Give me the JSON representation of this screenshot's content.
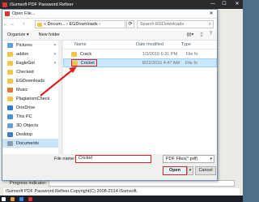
{
  "app": {
    "title": "iSumsoft PDF Password Refixer",
    "min": "—",
    "max": "☐",
    "close": "✕",
    "progress_label": "Progress indicator:",
    "footer": "iSumsoft PDF Password Refixer.Copyright(C) 2008-2014 iSumsoft."
  },
  "dialog": {
    "title": "Open File...",
    "close": "✕",
    "nav_back": "←",
    "nav_forward": "→",
    "nav_up": "↑",
    "breadcrumb": "« Docum... › EGDownloads ›",
    "search_placeholder": "Search EGDownloads",
    "toolbar": {
      "organize": "Organize ▾",
      "new_folder": "New folder"
    },
    "nav_items": [
      {
        "label": "Pictures",
        "pin": "✦",
        "color": "#5ea0d8"
      },
      {
        "label": "addon",
        "pin": "✦",
        "color": "#f3c649"
      },
      {
        "label": "EagleGet",
        "pin": "✦",
        "color": "#f3c649"
      },
      {
        "label": "Checked",
        "color": "#f3c649"
      },
      {
        "label": "EGDownloads",
        "color": "#f3c649"
      },
      {
        "label": "Music",
        "color": "#e07a30"
      },
      {
        "label": "PlagiarismCheck",
        "color": "#f3c649"
      },
      {
        "label": "OneDrive",
        "color": "#2f7bd3"
      },
      {
        "label": "This PC",
        "color": "#4a90d9"
      },
      {
        "label": "3D Objects",
        "color": "#6aa0d8"
      },
      {
        "label": "Desktop",
        "color": "#3d7fc4"
      },
      {
        "label": "Documents",
        "color": "#8a9bb0",
        "selected": true
      }
    ],
    "columns": {
      "name": "Name",
      "date": "Date modified",
      "type": "Type"
    },
    "files": [
      {
        "name": "Crack",
        "date": "1/3/2016 6:31 PM",
        "type": "File fo",
        "color": "#f3c649"
      },
      {
        "name": "Cricket",
        "date": "8/22/2016 4:47 AM",
        "type": "File fo",
        "color": "#f3c649",
        "selected": true
      }
    ],
    "file_name_label": "File name:",
    "file_name_value": "Cricket",
    "filter": "PDF Files(*.pdf)",
    "open": "Open",
    "cancel": "Cancel"
  },
  "colors": {
    "highlight": "#e02020",
    "selection": "#cce8ff"
  }
}
